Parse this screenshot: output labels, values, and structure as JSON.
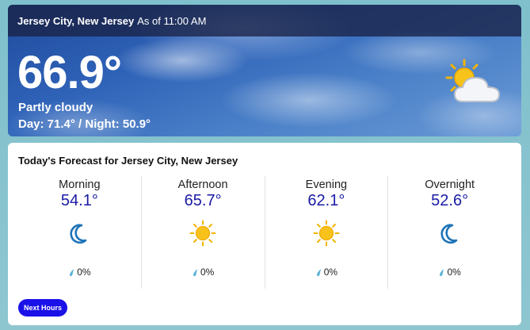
{
  "current": {
    "location": "Jersey City, New Jersey",
    "as_of": "As of 11:00 AM",
    "temperature": "66.9°",
    "condition": "Partly cloudy",
    "day_night": "Day: 71.4° / Night: 50.9°",
    "icon": "partly-cloudy-icon"
  },
  "forecast": {
    "title": "Today's Forecast for Jersey City, New Jersey",
    "periods": [
      {
        "label": "Morning",
        "temp": "54.1°",
        "icon": "moon-icon",
        "precip": "0%"
      },
      {
        "label": "Afternoon",
        "temp": "65.7°",
        "icon": "sun-icon",
        "precip": "0%"
      },
      {
        "label": "Evening",
        "temp": "62.1°",
        "icon": "sun-icon",
        "precip": "0%"
      },
      {
        "label": "Overnight",
        "temp": "52.6°",
        "icon": "moon-icon",
        "precip": "0%"
      }
    ],
    "next_button": "Next Hours"
  },
  "colors": {
    "accent": "#1a10e8",
    "temp_text": "#1a1aa6",
    "moon": "#1f74b8",
    "sun": "#f2b400"
  }
}
